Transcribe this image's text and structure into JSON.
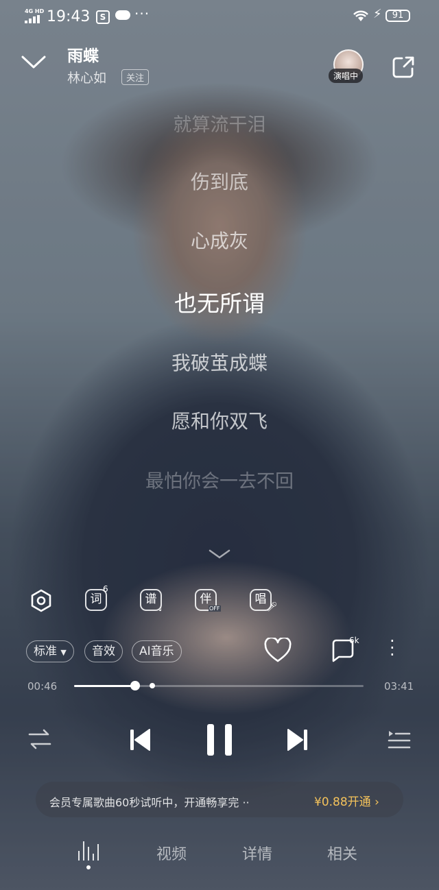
{
  "status_bar": {
    "network": "4G HD",
    "time": "19:43",
    "battery": "91"
  },
  "header": {
    "song_title": "雨蝶",
    "artist": "林心如",
    "follow_label": "关注",
    "live_badge": "演唱中"
  },
  "lyrics": [
    "就算流干泪",
    "伤到底",
    "心成灰",
    "也无所谓",
    "我破茧成蝶",
    "愿和你双飞",
    "最怕你会一去不回"
  ],
  "current_lyric_index": 3,
  "tools": {
    "lyric_icon_label": "词",
    "lyric_badge": "6",
    "score_icon_label": "谱",
    "accompany_icon_label": "伴",
    "accompany_state": "OFF",
    "sing_icon_label": "唱"
  },
  "quality": {
    "standard_label": "标准",
    "effects_label": "音效",
    "ai_music_label": "AI音乐"
  },
  "comment_count": "6k",
  "progress": {
    "current_time": "00:46",
    "total_time": "03:41",
    "fraction": 0.21,
    "trial_marker_fraction": 0.27
  },
  "vip_banner": {
    "text": "会员专属歌曲60秒试听中，开通畅享完 ··",
    "price_label": "¥0.88开通",
    "price_color": "#f4c25b"
  },
  "tabs": [
    "视频",
    "详情",
    "相关"
  ],
  "icons": [
    "chevron-down-icon",
    "share-icon",
    "settings-hex-icon",
    "heart-icon",
    "comment-icon",
    "more-vertical-icon",
    "repeat-icon",
    "previous-icon",
    "pause-icon",
    "next-icon",
    "playlist-icon",
    "equalizer-icon"
  ]
}
